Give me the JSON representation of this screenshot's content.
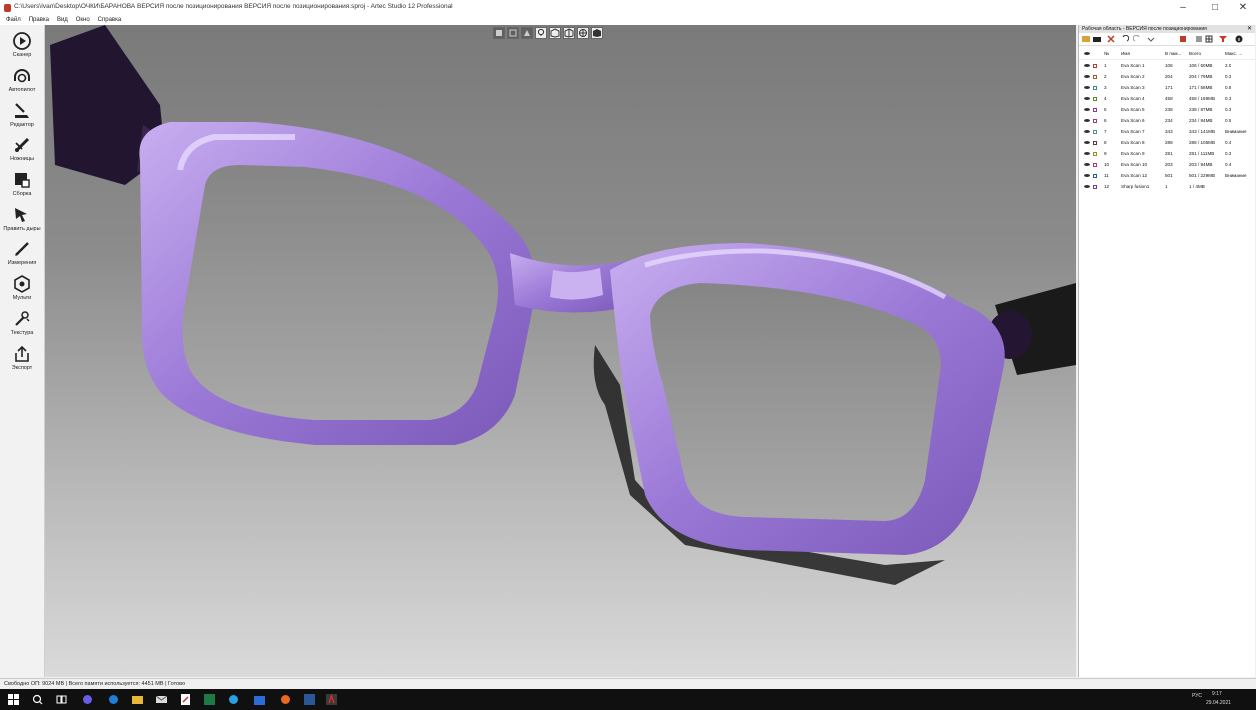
{
  "window": {
    "title": "C:\\Users\\Ivan\\Desktop\\ОЧКИ\\БАРАНОВА ВЕРСИЯ после позиционирования ВЕРСИЯ после позиционирования.sproj - Artec Studio 12 Professional",
    "controls": [
      "–",
      "□",
      "✕"
    ]
  },
  "menu": [
    "Файл",
    "Правка",
    "Вид",
    "Окно",
    "Справка"
  ],
  "tools": [
    {
      "label": "Сканер",
      "icon": "play-circle-icon"
    },
    {
      "label": "Автопилот",
      "icon": "autopilot-icon"
    },
    {
      "label": "Редактор",
      "icon": "eraser-icon"
    },
    {
      "label": "Ножницы",
      "icon": "scissors-icon"
    },
    {
      "label": "Сборка",
      "icon": "assembly-icon"
    },
    {
      "label": "Править дыры",
      "icon": "hole-fix-icon"
    },
    {
      "label": "Измерения",
      "icon": "measure-icon"
    },
    {
      "label": "Мульти",
      "icon": "multi-icon"
    },
    {
      "label": "Текстура",
      "icon": "texture-icon"
    },
    {
      "label": "Экспорт",
      "icon": "export-icon"
    }
  ],
  "panel": {
    "title": "Рабочая область - ВЕРСИЯ после позиционирования",
    "close": "✕",
    "columns": [
      "№",
      "Имя",
      "В пам...",
      "Всего",
      "Макс. ..."
    ],
    "rows": [
      {
        "num": "1",
        "name": "Eva Scan 1",
        "mem": "106",
        "total": "106 / 60MB",
        "max": "2.0",
        "color": "#b83a3a"
      },
      {
        "num": "2",
        "name": "Eva Scan 2",
        "mem": "204",
        "total": "204 / 79MB",
        "max": "0.3",
        "color": "#a65a2a"
      },
      {
        "num": "3",
        "name": "Eva Scan 3",
        "mem": "171",
        "total": "171 / 58MB",
        "max": "0.8",
        "color": "#3a8a8a"
      },
      {
        "num": "4",
        "name": "Eva Scan 4",
        "mem": "458",
        "total": "458 / 169MB",
        "max": "0.3",
        "color": "#5a8a2a"
      },
      {
        "num": "5",
        "name": "Eva Scan 5",
        "mem": "238",
        "total": "238 / 87MB",
        "max": "0.3",
        "color": "#8a3aa5"
      },
      {
        "num": "6",
        "name": "Eva Scan 6",
        "mem": "234",
        "total": "234 / 84MB",
        "max": "0.5",
        "color": "#9a3a8a"
      },
      {
        "num": "7",
        "name": "Eva Scan 7",
        "mem": "343",
        "total": "343 / 141MB",
        "max": "Внимание",
        "color": "#4a9a7a"
      },
      {
        "num": "8",
        "name": "Eva Scan 8",
        "mem": "288",
        "total": "288 / 105MB",
        "max": "0.4",
        "color": "#5a3a3a"
      },
      {
        "num": "9",
        "name": "Eva Scan 9",
        "mem": "281",
        "total": "281 / 111MB",
        "max": "0.3",
        "color": "#a58a2a"
      },
      {
        "num": "10",
        "name": "Eva Scan 10",
        "mem": "203",
        "total": "203 / 94MB",
        "max": "0.4",
        "color": "#b83a6a"
      },
      {
        "num": "11",
        "name": "Eva Scan 12",
        "mem": "501",
        "total": "501 / 229MB",
        "max": "Внимание",
        "color": "#2a5aa5"
      },
      {
        "num": "12",
        "name": "Sharp fusion1",
        "mem": "1",
        "total": "1 / 4MB",
        "max": "",
        "color": "#7a3aa5"
      }
    ]
  },
  "status": "Свободно ОП: 9024 MB  |  Всего памяти используется: 4451 MB  |  Готово",
  "tray": {
    "lang": "РУС",
    "time": "9:17",
    "date": "29.04.2021"
  },
  "colors": {
    "frame": "#9b7ad6",
    "frame_dark": "#5f3f98",
    "frame_highlight": "#d9c5f5",
    "strap": "#25162e"
  }
}
